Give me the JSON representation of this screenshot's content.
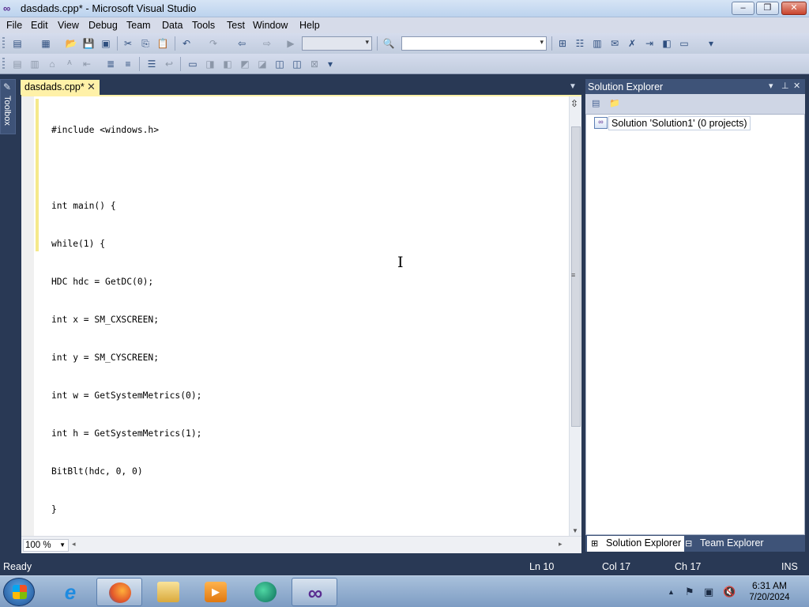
{
  "window": {
    "title": "dasdads.cpp* - Microsoft Visual Studio",
    "icon": "visual-studio-infinity-icon",
    "controls": [
      "minimize",
      "restore",
      "close"
    ]
  },
  "menu": [
    "File",
    "Edit",
    "View",
    "Debug",
    "Team",
    "Data",
    "Tools",
    "Test",
    "Window",
    "Help"
  ],
  "toolbar": {
    "solution_config_value": "",
    "find_box_value": ""
  },
  "toolbox": {
    "label": "Toolbox"
  },
  "editor": {
    "tab_name": "dasdads.cpp*",
    "zoom": "100 %",
    "code_lines": [
      "#include <windows.h>",
      "",
      "int main() {",
      "while(1) {",
      "HDC hdc = GetDC(0);",
      "int x = SM_CXSCREEN;",
      "int y = SM_CYSCREEN;",
      "int w = GetSystemMetrics(0);",
      "int h = GetSystemMetrics(1);",
      "BitBlt(hdc, 0, 0)",
      "}",
      "}"
    ]
  },
  "solution_explorer": {
    "title": "Solution Explorer",
    "root_node": "Solution 'Solution1' (0 projects)",
    "tabs": [
      {
        "label": "Solution Explorer",
        "icon": "solution-explorer-icon",
        "active": true
      },
      {
        "label": "Team Explorer",
        "icon": "team-explorer-icon",
        "active": false
      }
    ]
  },
  "statusbar": {
    "state": "Ready",
    "line": "Ln 10",
    "column": "Col 17",
    "char": "Ch 17",
    "mode": "INS"
  },
  "taskbar": {
    "apps": [
      {
        "name": "internet-explorer-icon",
        "running": false
      },
      {
        "name": "firefox-icon",
        "running": true
      },
      {
        "name": "file-explorer-icon",
        "running": false
      },
      {
        "name": "media-player-icon",
        "running": false
      },
      {
        "name": "app-icon",
        "running": false
      },
      {
        "name": "visual-studio-icon",
        "running": true
      }
    ],
    "clock_time": "6:31 AM",
    "clock_date": "7/20/2024"
  },
  "colors": {
    "ide_frame": "#293955",
    "tab_active": "#fff1a8",
    "tool_header": "#3e5378"
  }
}
